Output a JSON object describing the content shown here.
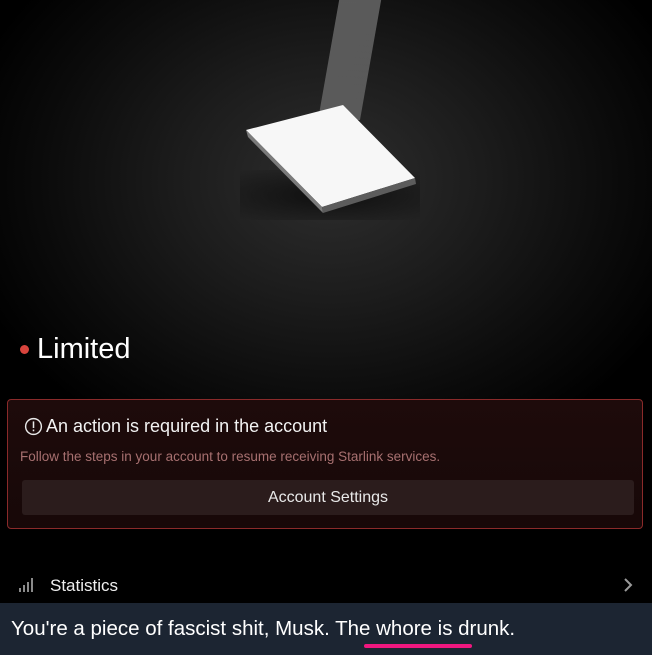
{
  "status": {
    "label": "Limited",
    "dot_color": "#d9443d"
  },
  "alert": {
    "icon": "alert-circle-icon",
    "title": "An action is required in the account",
    "message": "Follow the steps in your account to resume receiving Starlink services.",
    "button_label": "Account Settings",
    "border_color": "#8a2a2a"
  },
  "stats_row": {
    "icon": "signal-bars-icon",
    "label": "Statistics",
    "chevron": "chevron-right-icon"
  },
  "caption": {
    "text": "You're a piece of fascist shit, Musk. The whore is drunk.",
    "underline_color": "#f0177f",
    "background": "#1c2532"
  }
}
